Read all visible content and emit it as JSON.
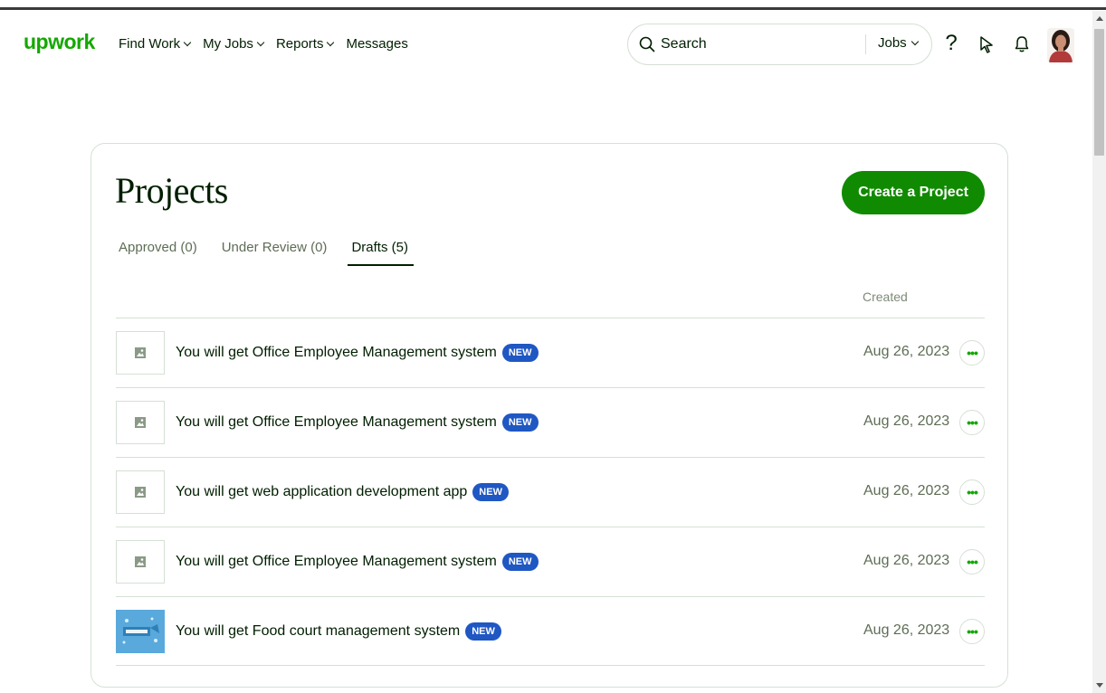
{
  "header": {
    "logo": "upwork",
    "nav": [
      {
        "label": "Find Work",
        "has_dropdown": true
      },
      {
        "label": "My Jobs",
        "has_dropdown": true
      },
      {
        "label": "Reports",
        "has_dropdown": true
      },
      {
        "label": "Messages",
        "has_dropdown": false
      }
    ],
    "search": {
      "placeholder": "Search",
      "scope": "Jobs"
    },
    "icons": [
      "help-icon",
      "cursor-icon",
      "bell-icon",
      "avatar"
    ]
  },
  "page": {
    "title": "Projects",
    "create_button": "Create a Project",
    "tabs": [
      {
        "label": "Approved (0)",
        "active": false
      },
      {
        "label": "Under Review (0)",
        "active": false
      },
      {
        "label": "Drafts (5)",
        "active": true
      }
    ],
    "column_created": "Created"
  },
  "projects": [
    {
      "title": "You will get Office Employee Management system",
      "badge": "NEW",
      "created": "Aug 26, 2023",
      "thumb": "placeholder"
    },
    {
      "title": "You will get Office Employee Management system",
      "badge": "NEW",
      "created": "Aug 26, 2023",
      "thumb": "placeholder"
    },
    {
      "title": "You will get web application development app",
      "badge": "NEW",
      "created": "Aug 26, 2023",
      "thumb": "placeholder"
    },
    {
      "title": "You will get Office Employee Management system",
      "badge": "NEW",
      "created": "Aug 26, 2023",
      "thumb": "placeholder"
    },
    {
      "title": "You will get Food court management system",
      "badge": "NEW",
      "created": "Aug 26, 2023",
      "thumb": "image"
    }
  ],
  "colors": {
    "brand": "#14a800",
    "button": "#108a00",
    "badge": "#1f57c3",
    "text": "#001e00",
    "muted": "#5e6d55",
    "border": "#d5e0d5"
  }
}
